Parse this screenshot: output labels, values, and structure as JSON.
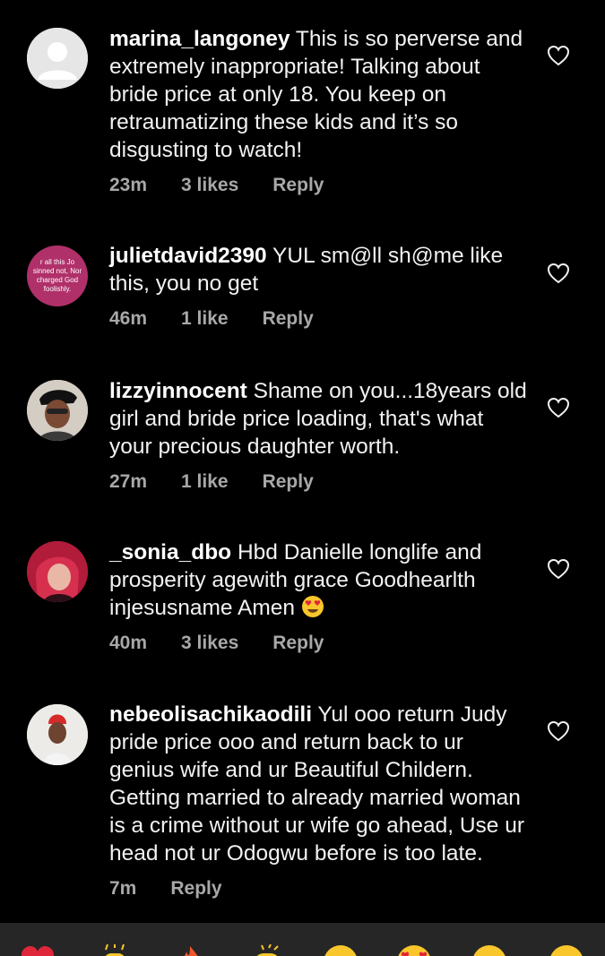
{
  "comments": [
    {
      "username": "marina_langoney",
      "text": "This is so perverse and extremely inappropriate! Talking about bride price at only 18. You keep on retraumatizing these kids and it’s so disgusting to watch!",
      "time": "23m",
      "likes": "3 likes",
      "reply": "Reply",
      "avatar": "default-avatar-icon"
    },
    {
      "username": "julietdavid2390",
      "text": "YUL sm@ll sh@me like this, you no get",
      "time": "46m",
      "likes": "1 like",
      "reply": "Reply",
      "avatar_text": "r all this Jo sinned not, Nor charged God foolishly."
    },
    {
      "username": "lizzyinnocent",
      "text": "Shame on you...18years old girl and bride price loading, that's what your precious daughter worth.",
      "time": "27m",
      "likes": "1 like",
      "reply": "Reply"
    },
    {
      "username": "_sonia_dbo",
      "text": "Hbd Danielle longlife and prosperity agewith grace Goodhearlth injesusname Amen",
      "time": "40m",
      "likes": "3 likes",
      "reply": "Reply",
      "emoji": "heart-eyes-emoji"
    },
    {
      "username": "nebeolisachikaodili",
      "text": "Yul ooo return Judy pride price ooo  and return back to ur genius wife and ur Beautiful Childern. Getting married to already married woman is a crime without ur wife go ahead, Use ur head not ur Odogwu before is too late.",
      "time": "7m",
      "likes": "",
      "reply": "Reply"
    }
  ],
  "reactions": [
    "red-heart",
    "raising-hands",
    "fire",
    "clapping-hands",
    "crying-face",
    "heart-eyes-face",
    "open-mouth-face",
    "laughing-face"
  ],
  "colors": {
    "background": "#000000",
    "text": "#f2f2f2",
    "meta": "#a8a8a8",
    "bottom_bar": "#262626"
  }
}
